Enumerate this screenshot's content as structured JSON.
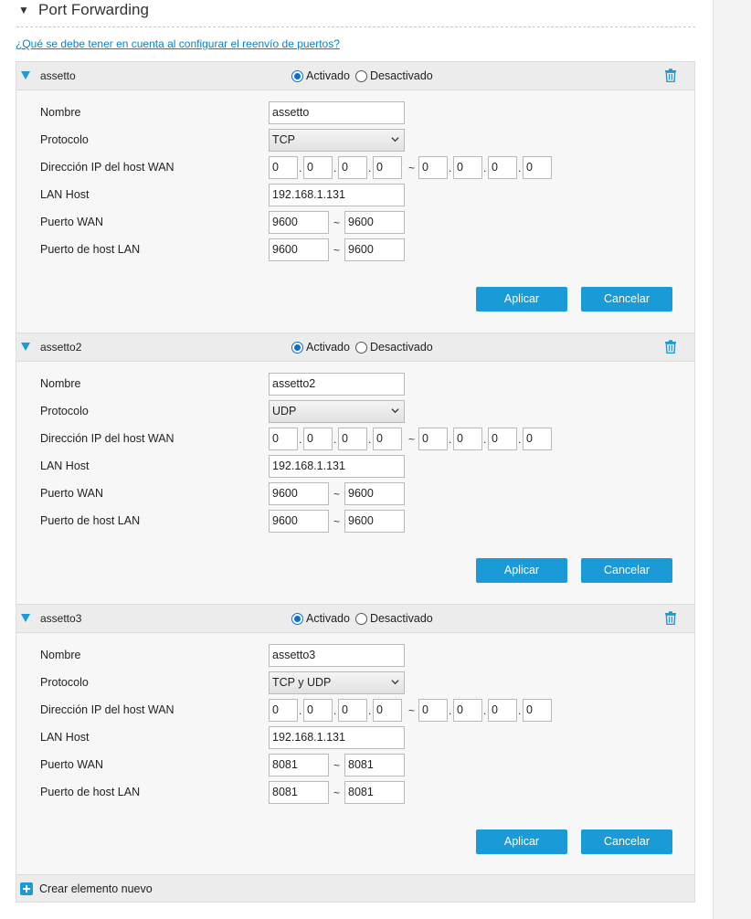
{
  "header": {
    "title": "Port Forwarding"
  },
  "help_link": "¿Qué se debe tener en cuenta al configurar el reenvío de puertos?",
  "labels": {
    "enabled": "Activado",
    "disabled": "Desactivado",
    "name": "Nombre",
    "protocol": "Protocolo",
    "wan_ip": "Dirección IP del host WAN",
    "lan_host": "LAN Host",
    "wan_port": "Puerto WAN",
    "lan_port": "Puerto de host LAN",
    "range_sep": "~",
    "dot": ".",
    "apply": "Aplicar",
    "cancel": "Cancelar"
  },
  "entries": [
    {
      "name": "assetto",
      "enabled": true,
      "protocol": "TCP",
      "wan_ip_start": [
        "0",
        "0",
        "0",
        "0"
      ],
      "wan_ip_end": [
        "0",
        "0",
        "0",
        "0"
      ],
      "lan_host": "192.168.1.131",
      "wan_port_start": "9600",
      "wan_port_end": "9600",
      "lan_port_start": "9600",
      "lan_port_end": "9600"
    },
    {
      "name": "assetto2",
      "enabled": true,
      "protocol": "UDP",
      "wan_ip_start": [
        "0",
        "0",
        "0",
        "0"
      ],
      "wan_ip_end": [
        "0",
        "0",
        "0",
        "0"
      ],
      "lan_host": "192.168.1.131",
      "wan_port_start": "9600",
      "wan_port_end": "9600",
      "lan_port_start": "9600",
      "lan_port_end": "9600"
    },
    {
      "name": "assetto3",
      "enabled": true,
      "protocol": "TCP y UDP",
      "wan_ip_start": [
        "0",
        "0",
        "0",
        "0"
      ],
      "wan_ip_end": [
        "0",
        "0",
        "0",
        "0"
      ],
      "lan_host": "192.168.1.131",
      "wan_port_start": "8081",
      "wan_port_end": "8081",
      "lan_port_start": "8081",
      "lan_port_end": "8081"
    }
  ],
  "create_new": "Crear elemento nuevo",
  "colors": {
    "accent": "#1a9ad6",
    "link": "#0a82c6",
    "radio": "#0a6fd0"
  },
  "icons": {
    "collapse": "triangle-down-icon",
    "delete": "trash-icon",
    "add": "plus-icon",
    "select": "chevron-down-icon"
  }
}
